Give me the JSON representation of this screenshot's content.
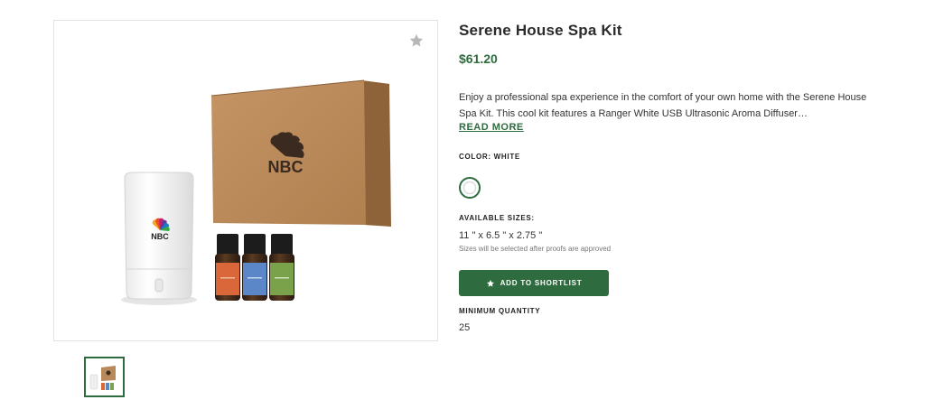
{
  "product": {
    "title": "Serene House Spa Kit",
    "price": "$61.20",
    "description": "Enjoy a professional spa experience in the comfort of your own home with the Serene House Spa Kit. This cool kit features a Ranger White USB Ultrasonic Aroma Diffuser…",
    "read_more_label": "READ MORE"
  },
  "gallery": {
    "main_image_alt": "Serene House Spa Kit with NBC branded diffuser, box and essential oils",
    "box_logo_text": "NBC",
    "diffuser_logo_text": "NBC",
    "favorite_icon": "star-icon"
  },
  "options": {
    "color_label": "COLOR: WHITE",
    "selected_color": "#ffffff",
    "sizes_label": "AVAILABLE SIZES:",
    "sizes_value": "11 \" x 6.5 \" x 2.75 \"",
    "sizes_note": "Sizes will be selected after proofs are approved"
  },
  "actions": {
    "shortlist_label": "ADD TO SHORTLIST",
    "shortlist_icon": "star-icon"
  },
  "quantity": {
    "label": "MINIMUM QUANTITY",
    "value": "25"
  },
  "colors": {
    "accent": "#2e6b3e",
    "kraft": "#b8895b"
  }
}
